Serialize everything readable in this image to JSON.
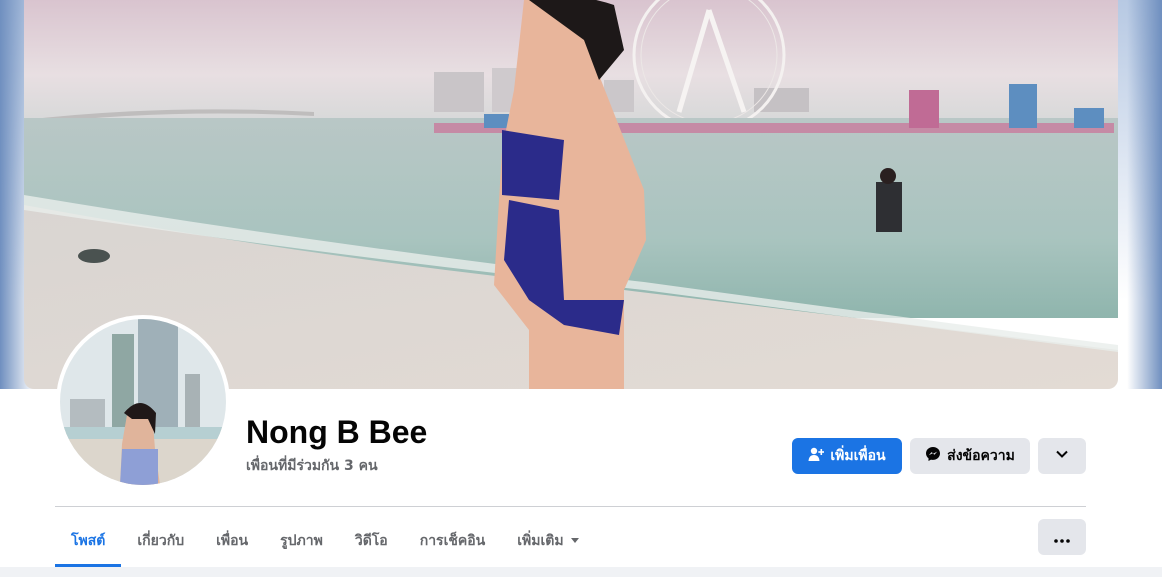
{
  "profile": {
    "name": "Nong B Bee",
    "mutual_friends": "เพื่อนที่มีร่วมกัน 3 คน"
  },
  "actions": {
    "add_friend_label": "เพิ่มเพื่อน",
    "message_label": "ส่งข้อความ",
    "more_icon": "chevron-down-icon",
    "add_friend_icon": "add-person-icon",
    "message_icon": "messenger-icon"
  },
  "tabs": [
    {
      "label": "โพสต์",
      "active": true
    },
    {
      "label": "เกี่ยวกับ",
      "active": false
    },
    {
      "label": "เพื่อน",
      "active": false
    },
    {
      "label": "รูปภาพ",
      "active": false
    },
    {
      "label": "วิดีโอ",
      "active": false
    },
    {
      "label": "การเช็คอิน",
      "active": false
    },
    {
      "label": "เพิ่มเติม",
      "active": false,
      "icon": "caret-down-icon"
    }
  ],
  "tab_menu_icon": "ellipsis-icon",
  "colors": {
    "accent": "#1b74e4",
    "button_secondary": "#e4e6eb",
    "text_primary": "#050505",
    "text_secondary": "#65676b"
  }
}
